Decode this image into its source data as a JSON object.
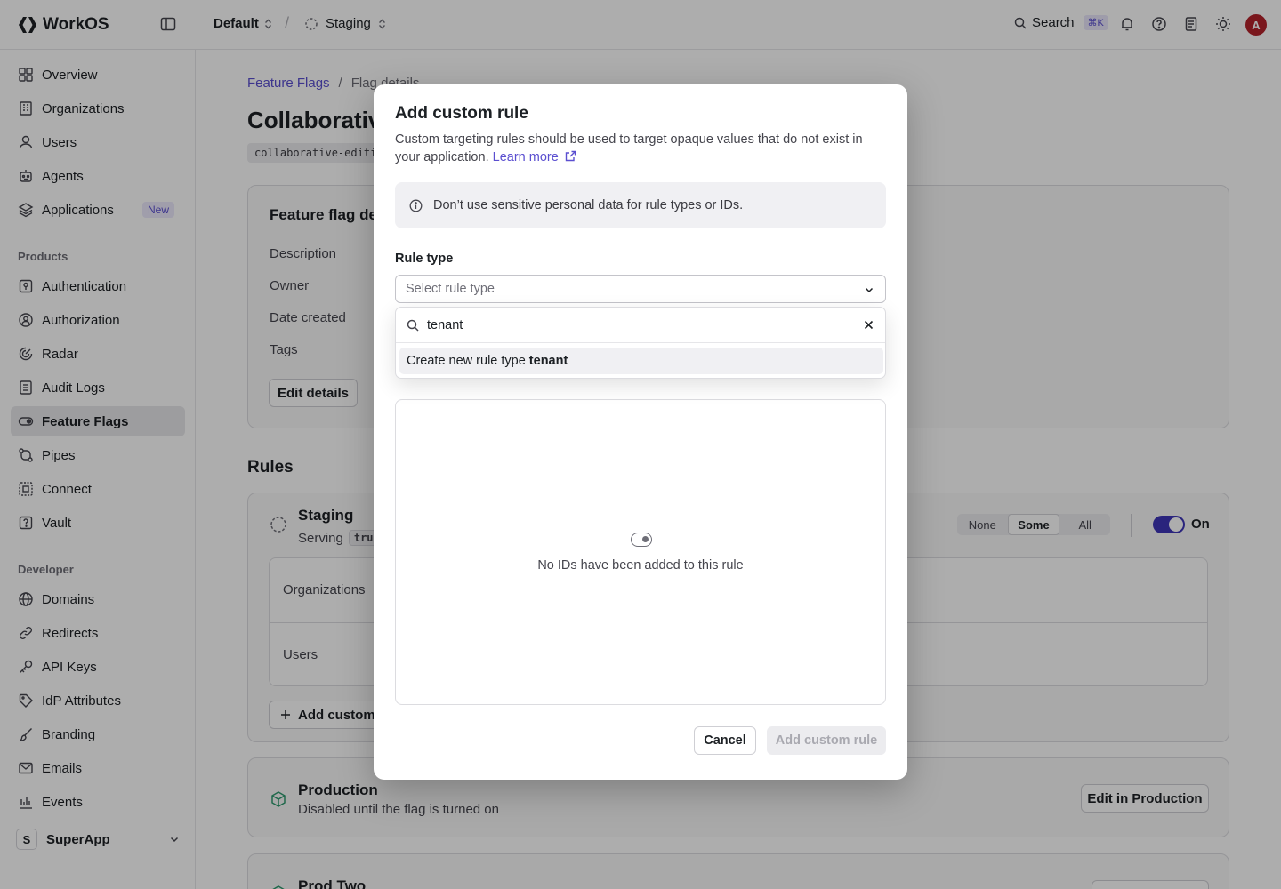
{
  "topbar": {
    "brand": "WorkOS",
    "environment": "Default",
    "separator": "/",
    "stage": "Staging",
    "search_label": "Search",
    "search_shortcut": "⌘K",
    "avatar_initial": "A"
  },
  "sidebar": {
    "items_top": [
      {
        "label": "Overview",
        "icon": "grid-icon"
      },
      {
        "label": "Organizations",
        "icon": "building-icon"
      },
      {
        "label": "Users",
        "icon": "user-icon"
      },
      {
        "label": "Agents",
        "icon": "robot-icon"
      },
      {
        "label": "Applications",
        "icon": "layers-icon",
        "badge": "New"
      }
    ],
    "products_heading": "Products",
    "products": [
      {
        "label": "Authentication",
        "icon": "key-square-icon"
      },
      {
        "label": "Authorization",
        "icon": "shield-user-icon"
      },
      {
        "label": "Radar",
        "icon": "radar-icon"
      },
      {
        "label": "Audit Logs",
        "icon": "list-icon"
      },
      {
        "label": "Feature Flags",
        "icon": "toggle-icon",
        "active": true
      },
      {
        "label": "Pipes",
        "icon": "pipes-icon"
      },
      {
        "label": "Connect",
        "icon": "connect-icon"
      },
      {
        "label": "Vault",
        "icon": "vault-icon"
      }
    ],
    "developer_heading": "Developer",
    "developer": [
      {
        "label": "Domains",
        "icon": "globe-icon"
      },
      {
        "label": "Redirects",
        "icon": "link-icon"
      },
      {
        "label": "API Keys",
        "icon": "key-icon"
      },
      {
        "label": "IdP Attributes",
        "icon": "tag-icon"
      },
      {
        "label": "Branding",
        "icon": "brush-icon"
      },
      {
        "label": "Emails",
        "icon": "mail-icon"
      },
      {
        "label": "Events",
        "icon": "events-icon"
      }
    ],
    "workspace_initial": "S",
    "workspace_name": "SuperApp"
  },
  "main": {
    "breadcrumb_root": "Feature Flags",
    "breadcrumb_sep": "/",
    "breadcrumb_current": "Flag details",
    "title": "Collaborative",
    "slug": "collaborative-editin",
    "details_title": "Feature flag det",
    "details_labels": [
      "Description",
      "Owner",
      "Date created",
      "Tags"
    ],
    "edit_details": "Edit details",
    "rules_title": "Rules",
    "staging": {
      "name": "Staging",
      "serving_label": "Serving",
      "serving_value": "true",
      "segments": [
        "None",
        "Some",
        "All"
      ],
      "selected_segment": "Some",
      "toggle_label": "On",
      "rows": [
        "Organizations",
        "Users"
      ],
      "add_button": "Add custom"
    },
    "production": {
      "name": "Production",
      "subtitle": "Disabled until the flag is turned on",
      "button": "Edit in Production"
    },
    "prod_two": {
      "name": "Prod Two"
    }
  },
  "modal": {
    "title": "Add custom rule",
    "description": "Custom targeting rules should be used to target opaque values that do not exist in your application.",
    "learn_more": "Learn more",
    "callout": "Don’t use sensitive personal data for rule types or IDs.",
    "rule_type_label": "Rule type",
    "select_placeholder": "Select rule type",
    "empty_text": "No IDs have been added to this rule",
    "cancel": "Cancel",
    "submit": "Add custom rule"
  },
  "dropdown": {
    "search_value": "tenant",
    "option_prefix": "Create new rule type",
    "option_value": "tenant"
  },
  "colors": {
    "accent": "#5b4fd0",
    "toggle_on": "#3e35b8"
  }
}
